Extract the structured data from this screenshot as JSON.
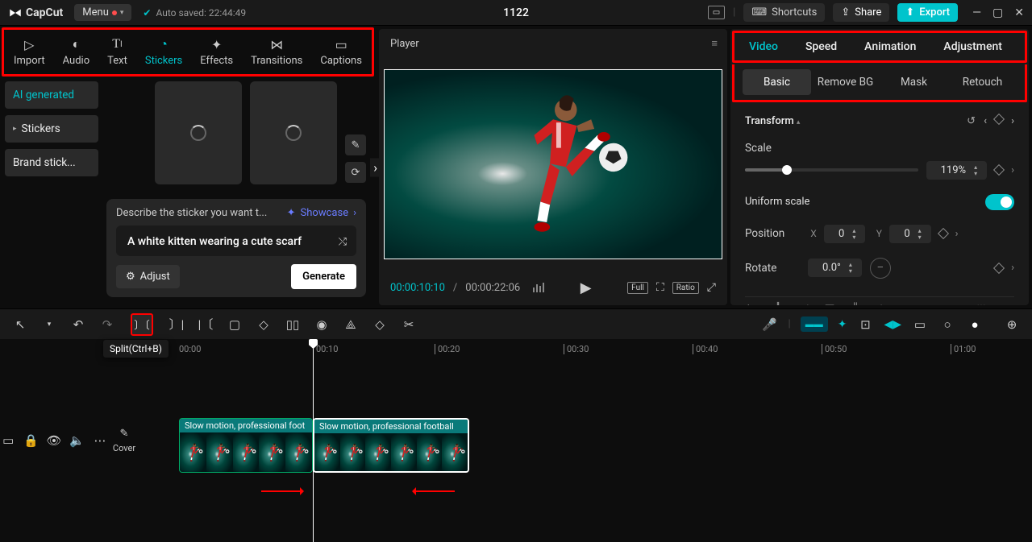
{
  "app": {
    "name": "CapCut",
    "menu": "Menu",
    "autosave": "Auto saved: 22:44:49",
    "title": "1122"
  },
  "topright": {
    "shortcuts": "Shortcuts",
    "share": "Share",
    "export": "Export"
  },
  "tabs": {
    "import": "Import",
    "audio": "Audio",
    "text": "Text",
    "stickers": "Stickers",
    "effects": "Effects",
    "transitions": "Transitions",
    "captions": "Captions"
  },
  "side": {
    "ai": "AI generated",
    "stickers": "Stickers",
    "brand": "Brand stick..."
  },
  "prompt": {
    "describe": "Describe the sticker you want t...",
    "showcase": "Showcase",
    "text": "A white kitten wearing a cute scarf",
    "adjust": "Adjust",
    "generate": "Generate"
  },
  "player": {
    "label": "Player",
    "time_current": "00:00:10:10",
    "time_total": "00:00:22:06",
    "full": "Full",
    "ratio": "Ratio"
  },
  "rp_tabs": {
    "video": "Video",
    "speed": "Speed",
    "animation": "Animation",
    "adjustment": "Adjustment"
  },
  "rp_sub": {
    "basic": "Basic",
    "removebg": "Remove BG",
    "mask": "Mask",
    "retouch": "Retouch"
  },
  "transform": {
    "title": "Transform",
    "scale": "Scale",
    "scale_val": "119%",
    "uniform": "Uniform scale",
    "position": "Position",
    "x": "0",
    "y": "0",
    "rotate": "Rotate",
    "rotate_val": "0.0°"
  },
  "tooltip": "Split(Ctrl+B)",
  "timeline": {
    "cover": "Cover",
    "marks": [
      "00:00",
      "00:10",
      "00:20",
      "00:30",
      "00:40",
      "00:50",
      "01:00"
    ],
    "clip1": "Slow motion, professional foot",
    "clip2": "Slow motion, professional football"
  }
}
